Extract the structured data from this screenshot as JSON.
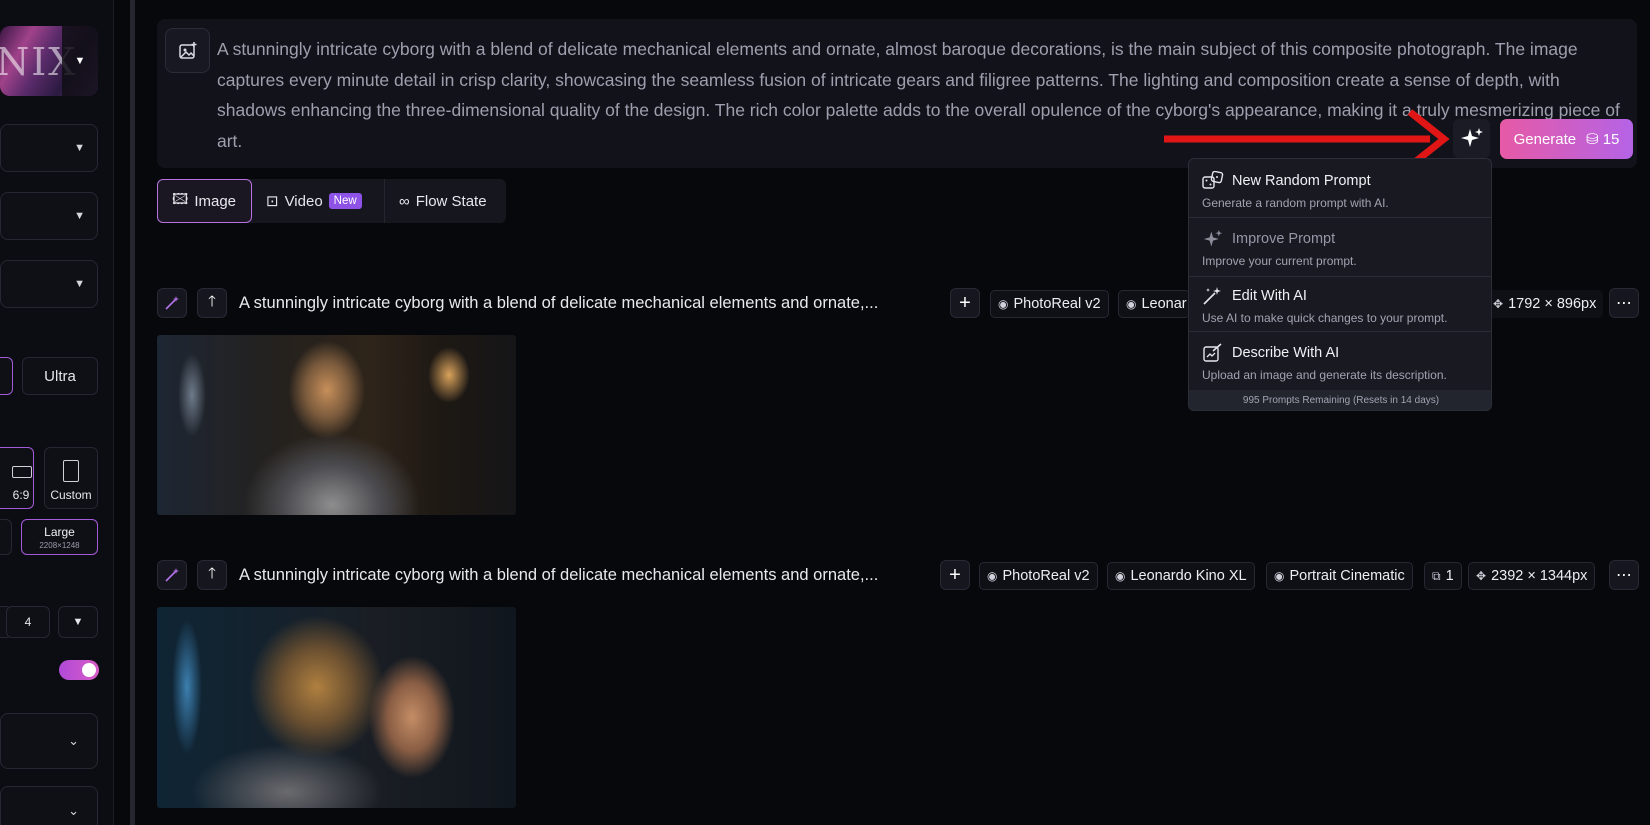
{
  "sidebar": {
    "model_text": "NIX",
    "quality_option": "Ultra",
    "ratio_active": "6:9",
    "ratio_custom": "Custom",
    "size_label": "Large",
    "size_dims": "2208×1248",
    "image_count": "4"
  },
  "prompt": {
    "text": "A stunningly intricate cyborg with a blend of delicate mechanical elements and ornate, almost baroque decorations, is the main subject of this composite photograph. The image captures every minute detail in crisp clarity, showcasing the seamless fusion of intricate gears and filigree patterns. The lighting and composition create a sense of depth, with shadows enhancing the three-dimensional quality of the design. The rich color palette adds to the overall opulence of the cyborg's appearance, making it a truly mesmerizing piece of art.",
    "generate_label": "Generate",
    "generate_cost": "15"
  },
  "tabs": [
    {
      "label": "Image"
    },
    {
      "label": "Video",
      "badge": "New"
    },
    {
      "label": "Flow State"
    }
  ],
  "generations": [
    {
      "title": "A stunningly intricate cyborg with a blend of delicate mechanical elements and ornate,...",
      "model": "PhotoReal v2",
      "preset": "Leonar",
      "dimensions": "1792 × 896px"
    },
    {
      "title": "A stunningly intricate cyborg with a blend of delicate mechanical elements and ornate,...",
      "model": "PhotoReal v2",
      "preset": "Leonardo Kino XL",
      "style": "Portrait Cinematic",
      "count": "1",
      "dimensions": "2392 × 1344px"
    }
  ],
  "menu": {
    "items": [
      {
        "title": "New Random Prompt",
        "desc": "Generate a random prompt with AI.",
        "icon": "dice-icon"
      },
      {
        "title": "Improve Prompt",
        "desc": "Improve your current prompt.",
        "icon": "sparkle-icon"
      },
      {
        "title": "Edit With AI",
        "desc": "Use AI to make quick changes to your prompt.",
        "icon": "magic-wand-icon"
      },
      {
        "title": "Describe With AI",
        "desc": "Upload an image and generate its description.",
        "icon": "describe-icon"
      }
    ],
    "footer": "995 Prompts Remaining (Resets in 14 days)"
  },
  "colors": {
    "accent_gradient_start": "#e65aa6",
    "accent_gradient_end": "#b463e6",
    "annotation_arrow": "#e01616"
  }
}
